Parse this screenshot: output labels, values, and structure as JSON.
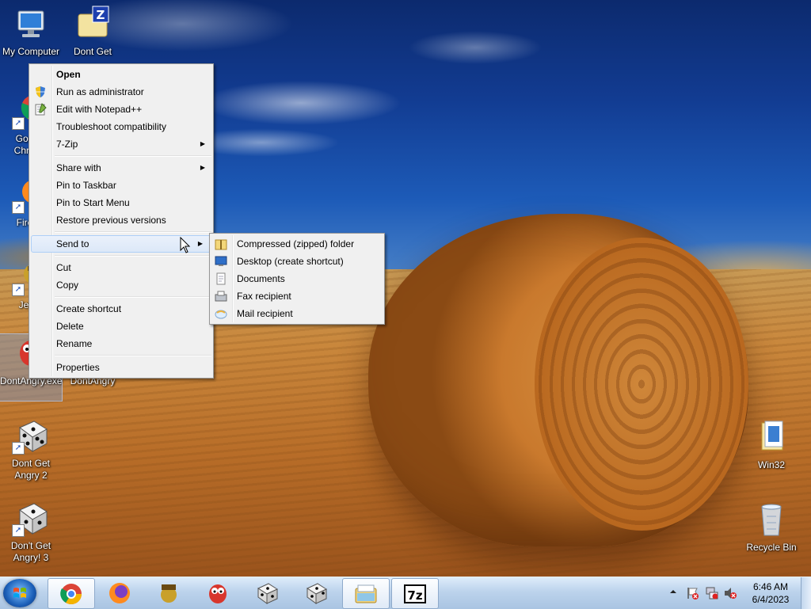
{
  "desktop": {
    "icons": [
      {
        "label": "My Computer"
      },
      {
        "label": "Dont Get Angry 2"
      },
      {
        "label": "Google Chrome"
      },
      {
        "label": "Firefox"
      },
      {
        "label": "Jewel"
      },
      {
        "label": "DontAngry.exe"
      },
      {
        "label": "DontAngry"
      },
      {
        "label": "Dont Get Angry 2"
      },
      {
        "label": "Don't Get Angry! 3"
      },
      {
        "label": "Win32"
      },
      {
        "label": "Recycle Bin"
      }
    ]
  },
  "context_menu": {
    "items": [
      {
        "label": "Open"
      },
      {
        "label": "Run as administrator"
      },
      {
        "label": "Edit with Notepad++"
      },
      {
        "label": "Troubleshoot compatibility"
      },
      {
        "label": "7-Zip"
      },
      {
        "label": "Share with"
      },
      {
        "label": "Pin to Taskbar"
      },
      {
        "label": "Pin to Start Menu"
      },
      {
        "label": "Restore previous versions"
      },
      {
        "label": "Send to"
      },
      {
        "label": "Cut"
      },
      {
        "label": "Copy"
      },
      {
        "label": "Create shortcut"
      },
      {
        "label": "Delete"
      },
      {
        "label": "Rename"
      },
      {
        "label": "Properties"
      }
    ]
  },
  "send_to_menu": {
    "items": [
      {
        "label": "Compressed (zipped) folder"
      },
      {
        "label": "Desktop (create shortcut)"
      },
      {
        "label": "Documents"
      },
      {
        "label": "Fax recipient"
      },
      {
        "label": "Mail recipient"
      }
    ]
  },
  "taskbar": {
    "buttons": [
      {
        "icon": "chrome-icon"
      },
      {
        "icon": "firefox-icon"
      },
      {
        "icon": "jewel-icon"
      },
      {
        "icon": "dontangry-icon"
      },
      {
        "icon": "dice-icon"
      },
      {
        "icon": "dice-icon"
      },
      {
        "icon": "explorer-icon"
      },
      {
        "icon": "7zip-icon"
      }
    ],
    "clock": {
      "time": "6:46 AM",
      "date": "6/4/2023"
    }
  },
  "colors": {
    "menu_bg": "#f0f0f0",
    "highlight": "#dce8f8",
    "taskbar": "#bcd3ec"
  }
}
